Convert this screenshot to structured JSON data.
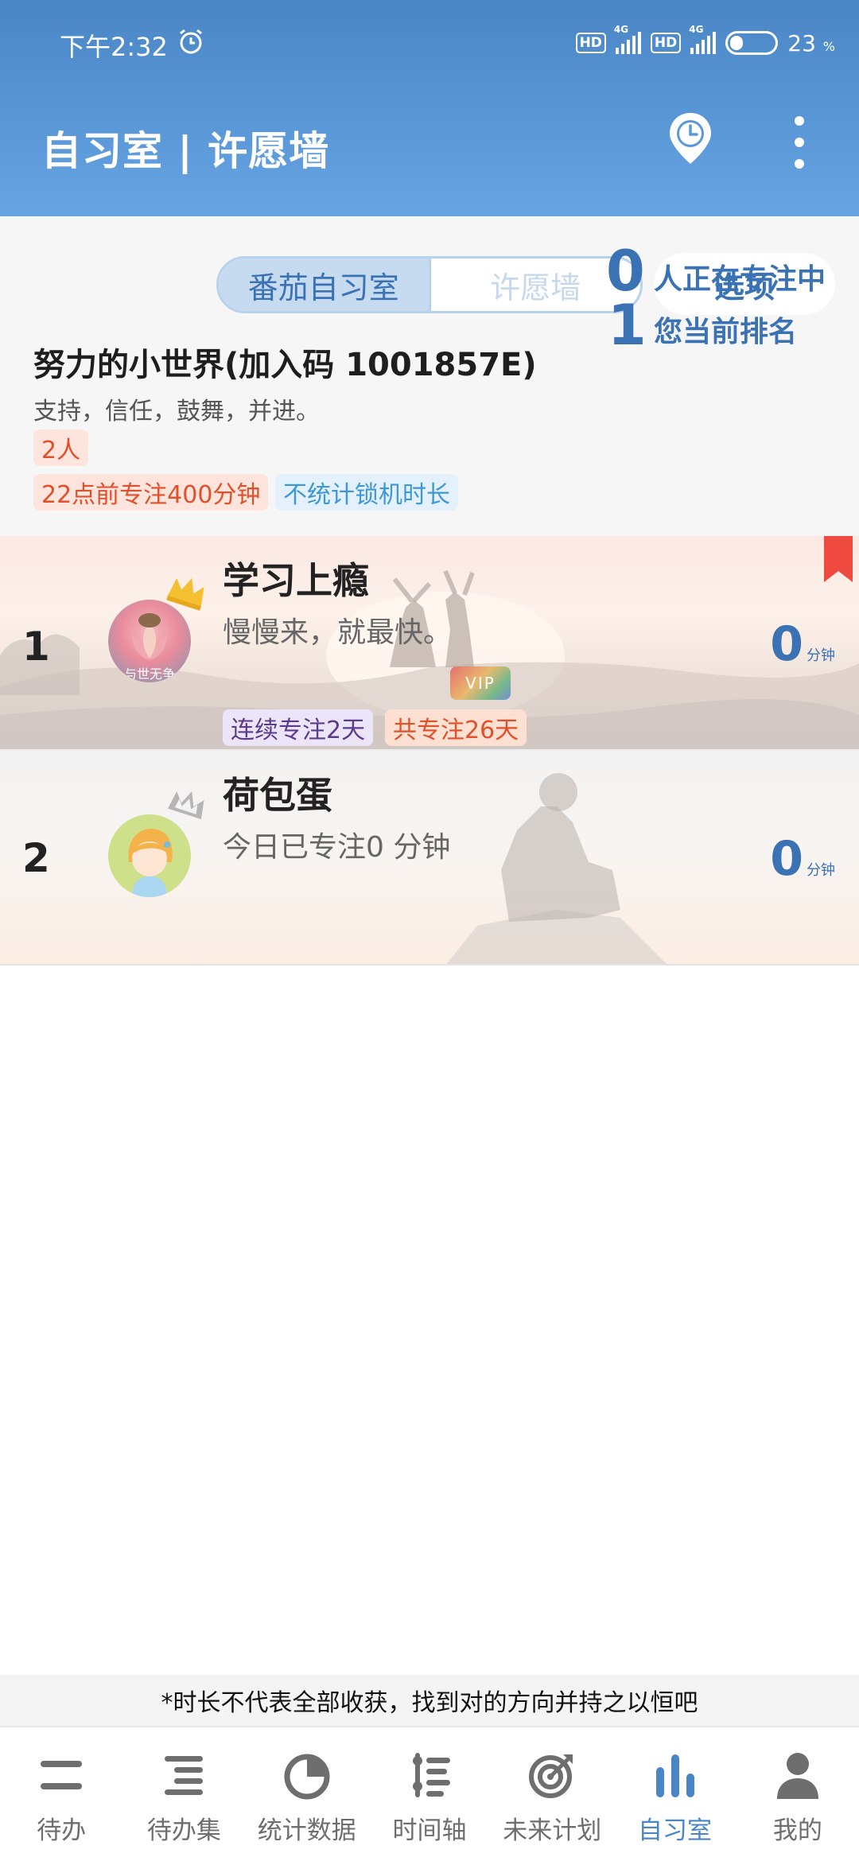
{
  "status_bar": {
    "time": "下午2:32",
    "hd_badge": "HD",
    "network": "4G",
    "battery_percent": "23",
    "battery_unit": "%"
  },
  "header": {
    "title": "自习室 | 许愿墙",
    "icons": [
      "clock-pin-icon",
      "more-vertical-icon"
    ]
  },
  "segment": {
    "tabs": [
      {
        "label": "番茄自习室",
        "selected": true
      },
      {
        "label": "许愿墙",
        "selected": false
      }
    ],
    "options_label": "选项"
  },
  "room": {
    "name": "努力的小世界(加入码 1001857E)",
    "motto": "支持，信任，鼓舞，并进。",
    "member_count": "2人",
    "goal_tag": "22点前专注400分钟",
    "lock_tag": "不统计锁机时长",
    "focusing_count": "0",
    "focusing_label": "人正在专注中",
    "my_rank": "1",
    "my_rank_label": "您当前排名"
  },
  "ranking": [
    {
      "rank": "1",
      "name": "学习上瘾",
      "subtitle": "慢慢来，就最快。",
      "avatar_caption": "与世无争",
      "vip": "VIP",
      "streak": "连续专注2天",
      "total": "共专注26天",
      "minutes": "0",
      "unit": "分钟",
      "crown": "gold"
    },
    {
      "rank": "2",
      "name": "荷包蛋",
      "subtitle": "今日已专注0 分钟",
      "minutes": "0",
      "unit": "分钟",
      "crown": "silver"
    }
  ],
  "footer_note": "*时长不代表全部收获，找到对的方向并持之以恒吧",
  "tabbar": {
    "active_index": 5,
    "items": [
      {
        "label": "待办",
        "icon": "todo-icon"
      },
      {
        "label": "待办集",
        "icon": "todo-set-icon"
      },
      {
        "label": "统计数据",
        "icon": "pie-chart-icon"
      },
      {
        "label": "时间轴",
        "icon": "timeline-icon"
      },
      {
        "label": "未来计划",
        "icon": "target-icon"
      },
      {
        "label": "自习室",
        "icon": "bar-chart-icon"
      },
      {
        "label": "我的",
        "icon": "user-icon"
      }
    ]
  },
  "colors": {
    "accent": "#3a72b4",
    "header": "#5b98d8",
    "tag_red": "#e0502a",
    "tag_blue": "#3d98d6"
  }
}
